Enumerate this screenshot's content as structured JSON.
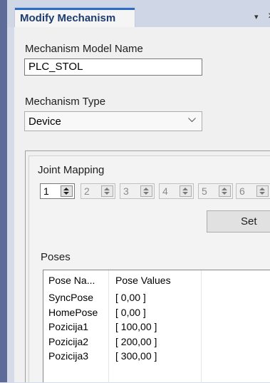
{
  "panel": {
    "tab_title": "Modify Mechanism",
    "menu_glyph": "▾",
    "close_glyph": "×"
  },
  "model_name": {
    "label": "Mechanism Model Name",
    "value": "PLC_STOL"
  },
  "mechanism_type": {
    "label": "Mechanism Type",
    "selected": "Device"
  },
  "joint_mapping": {
    "label": "Joint Mapping",
    "values": [
      "1",
      "2",
      "3",
      "4",
      "5",
      "6"
    ],
    "active_index": 0,
    "set_label": "Set"
  },
  "poses": {
    "label": "Poses",
    "columns": [
      "Pose Na...",
      "Pose Values"
    ],
    "rows": [
      {
        "name": "SyncPose",
        "values": "[ 0,00 ]"
      },
      {
        "name": "HomePose",
        "values": "[ 0,00 ]"
      },
      {
        "name": "Pozicija1",
        "values": "[ 100,00 ]"
      },
      {
        "name": "Pozicija2",
        "values": "[ 200,00 ]"
      },
      {
        "name": "Pozicija3",
        "values": "[ 300,00 ]"
      }
    ]
  },
  "colors": {
    "accent": "#2a6cc8",
    "tab_title": "#1e3c6e",
    "side_bar": "#5d6b99"
  }
}
